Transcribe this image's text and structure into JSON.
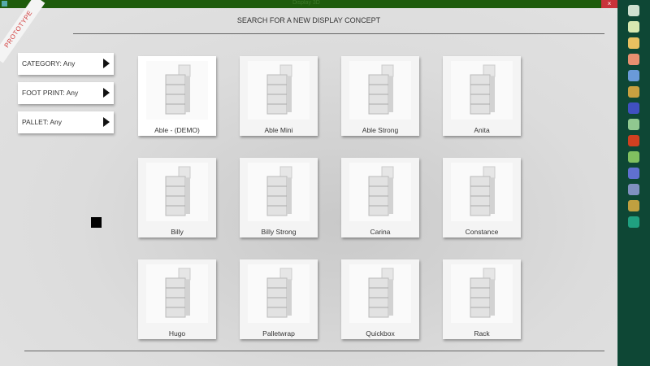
{
  "window": {
    "title": "Display 3D"
  },
  "ribbon": "PROTOTYPE",
  "heading": "SEARCH FOR A NEW DISPLAY CONCEPT",
  "filters": [
    {
      "label": "CATEGORY: Any"
    },
    {
      "label": "FOOT PRINT: Any"
    },
    {
      "label": "PALLET: Any"
    }
  ],
  "concepts": [
    {
      "name": "Able - (DEMO)"
    },
    {
      "name": "Able Mini"
    },
    {
      "name": "Able Strong"
    },
    {
      "name": "Anita"
    },
    {
      "name": "Billy"
    },
    {
      "name": "Billy Strong"
    },
    {
      "name": "Carina"
    },
    {
      "name": "Constance"
    },
    {
      "name": "Hugo"
    },
    {
      "name": "Palletwrap"
    },
    {
      "name": "Quickbox"
    },
    {
      "name": "Rack"
    }
  ],
  "taskbar_colors": [
    "#cfe0d0",
    "#d8e8b0",
    "#e8c060",
    "#e89070",
    "#6a9ad8",
    "#c8a040",
    "#4050c0",
    "#90c890",
    "#d04020",
    "#80c060",
    "#6070d0",
    "#8090c0",
    "#c0a040",
    "#20a080"
  ]
}
